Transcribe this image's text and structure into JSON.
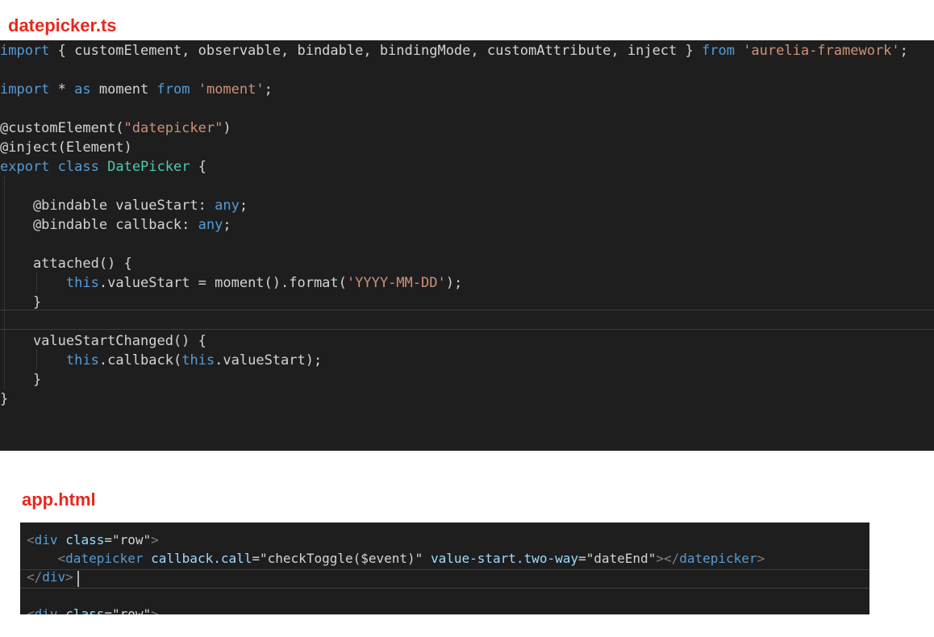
{
  "labels": {
    "file1": "datepicker.ts",
    "file2": "app.html"
  },
  "code1": [
    [
      [
        "kw",
        "import"
      ],
      [
        "pl",
        " { customElement, observable, bindable, bindingMode, customAttribute, inject } "
      ],
      [
        "kw",
        "from"
      ],
      [
        "pl",
        " "
      ],
      [
        "str",
        "'aurelia-framework'"
      ],
      [
        "pl",
        ";"
      ]
    ],
    [],
    [
      [
        "kw",
        "import"
      ],
      [
        "pl",
        " * "
      ],
      [
        "kw",
        "as"
      ],
      [
        "pl",
        " moment "
      ],
      [
        "kw",
        "from"
      ],
      [
        "pl",
        " "
      ],
      [
        "str",
        "'moment'"
      ],
      [
        "pl",
        ";"
      ]
    ],
    [],
    [
      [
        "pl",
        "@customElement("
      ],
      [
        "str",
        "\"datepicker\""
      ],
      [
        "pl",
        ")"
      ]
    ],
    [
      [
        "pl",
        "@inject(Element)"
      ]
    ],
    [
      [
        "kw",
        "export"
      ],
      [
        "pl",
        " "
      ],
      [
        "kw",
        "class"
      ],
      [
        "pl",
        " "
      ],
      [
        "typ",
        "DatePicker"
      ],
      [
        "pl",
        " {"
      ]
    ],
    [],
    [
      [
        "pl",
        "    @bindable valueStart: "
      ],
      [
        "kw",
        "any"
      ],
      [
        "pl",
        ";"
      ]
    ],
    [
      [
        "pl",
        "    @bindable callback: "
      ],
      [
        "kw",
        "any"
      ],
      [
        "pl",
        ";"
      ]
    ],
    [],
    [
      [
        "pl",
        "    attached() {"
      ]
    ],
    [
      [
        "pl",
        "        "
      ],
      [
        "kw",
        "this"
      ],
      [
        "pl",
        ".valueStart = moment().format("
      ],
      [
        "str",
        "'YYYY-MM-DD'"
      ],
      [
        "pl",
        ");"
      ]
    ],
    [
      [
        "pl",
        "    }"
      ]
    ],
    [],
    [
      [
        "pl",
        "    valueStartChanged() {"
      ]
    ],
    [
      [
        "pl",
        "        "
      ],
      [
        "kw",
        "this"
      ],
      [
        "pl",
        ".callback("
      ],
      [
        "kw",
        "this"
      ],
      [
        "pl",
        ".valueStart);"
      ]
    ],
    [
      [
        "pl",
        "    }"
      ]
    ],
    [
      [
        "pl",
        "}"
      ]
    ]
  ],
  "code2": [
    [
      [
        "punc",
        "<"
      ],
      [
        "tag",
        "div"
      ],
      [
        "pl",
        " "
      ],
      [
        "attr",
        "class"
      ],
      [
        "pl",
        "="
      ],
      [
        "pl",
        "\"row\""
      ],
      [
        "punc",
        ">"
      ]
    ],
    [
      [
        "pl",
        "    "
      ],
      [
        "punc",
        "<"
      ],
      [
        "tag",
        "datepicker"
      ],
      [
        "pl",
        " "
      ],
      [
        "attr",
        "callback.call"
      ],
      [
        "pl",
        "="
      ],
      [
        "pl",
        "\"checkToggle($event)\""
      ],
      [
        "pl",
        " "
      ],
      [
        "attr",
        "value-start.two-way"
      ],
      [
        "pl",
        "="
      ],
      [
        "pl",
        "\"dateEnd\""
      ],
      [
        "punc",
        "></"
      ],
      [
        "tag",
        "datepicker"
      ],
      [
        "punc",
        ">"
      ]
    ],
    [
      [
        "punc",
        "</"
      ],
      [
        "tag",
        "div"
      ],
      [
        "punc",
        ">"
      ]
    ],
    [],
    [
      [
        "punc",
        "<"
      ],
      [
        "tag",
        "div"
      ],
      [
        "pl",
        " "
      ],
      [
        "attr",
        "class"
      ],
      [
        "pl",
        "="
      ],
      [
        "pl",
        "\"row\""
      ],
      [
        "punc",
        ">"
      ]
    ]
  ]
}
